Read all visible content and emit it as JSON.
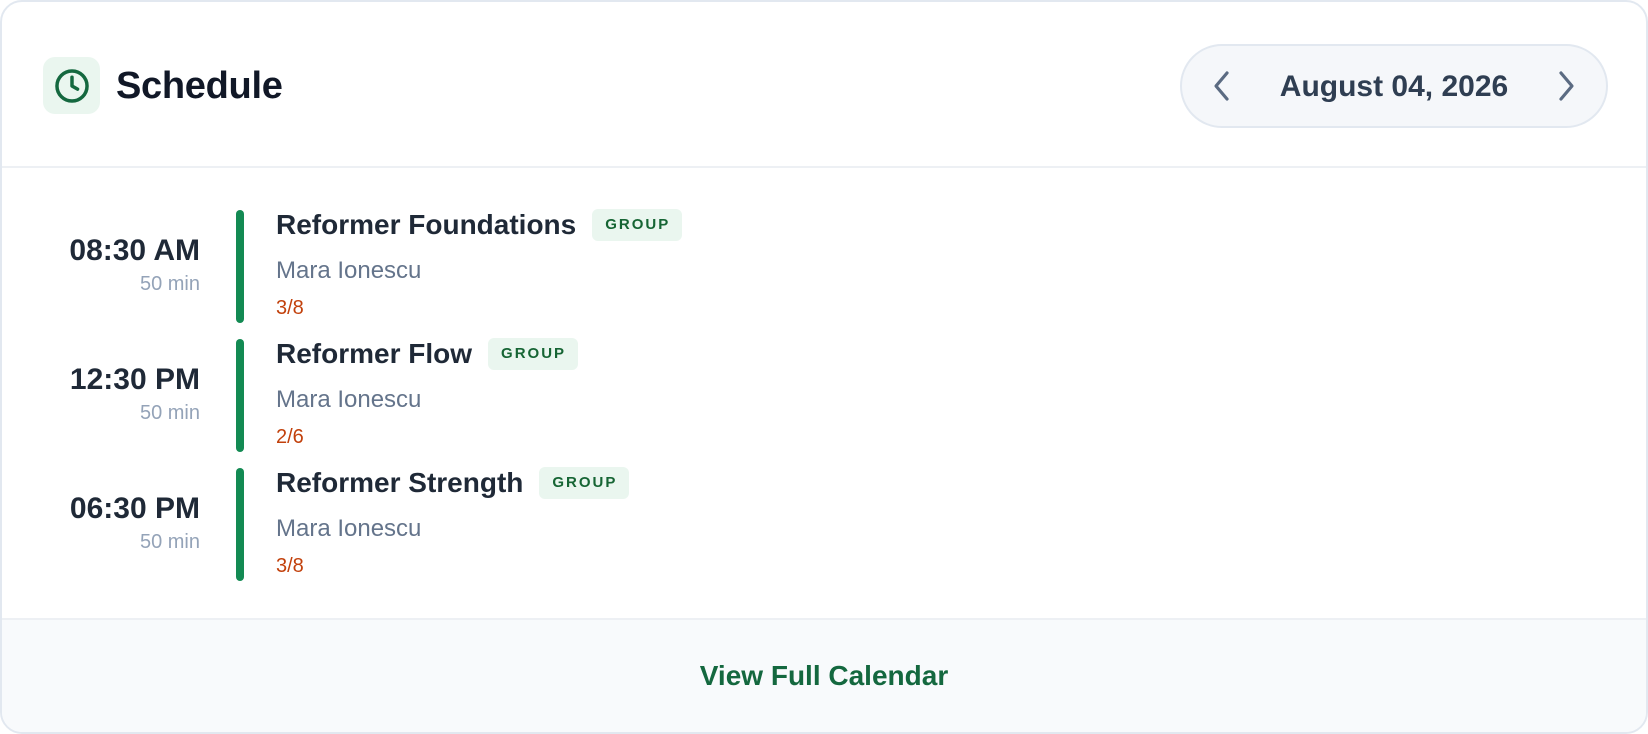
{
  "header": {
    "title": "Schedule",
    "icon": "clock-icon",
    "date_label": "August 04, 2026",
    "prev_icon": "chevron-left-icon",
    "next_icon": "chevron-right-icon"
  },
  "sessions": [
    {
      "time": "08:30 AM",
      "duration": "50 min",
      "name": "Reformer Foundations",
      "tag": "GROUP",
      "instructor": "Mara Ionescu",
      "capacity": "3/8"
    },
    {
      "time": "12:30 PM",
      "duration": "50 min",
      "name": "Reformer Flow",
      "tag": "GROUP",
      "instructor": "Mara Ionescu",
      "capacity": "2/6"
    },
    {
      "time": "06:30 PM",
      "duration": "50 min",
      "name": "Reformer Strength",
      "tag": "GROUP",
      "instructor": "Mara Ionescu",
      "capacity": "3/8"
    }
  ],
  "footer": {
    "link_label": "View Full Calendar"
  },
  "colors": {
    "accent": "#138a53",
    "accent_dark": "#14683f",
    "tag_bg": "#eaf6ef",
    "capacity": "#c2410c"
  }
}
